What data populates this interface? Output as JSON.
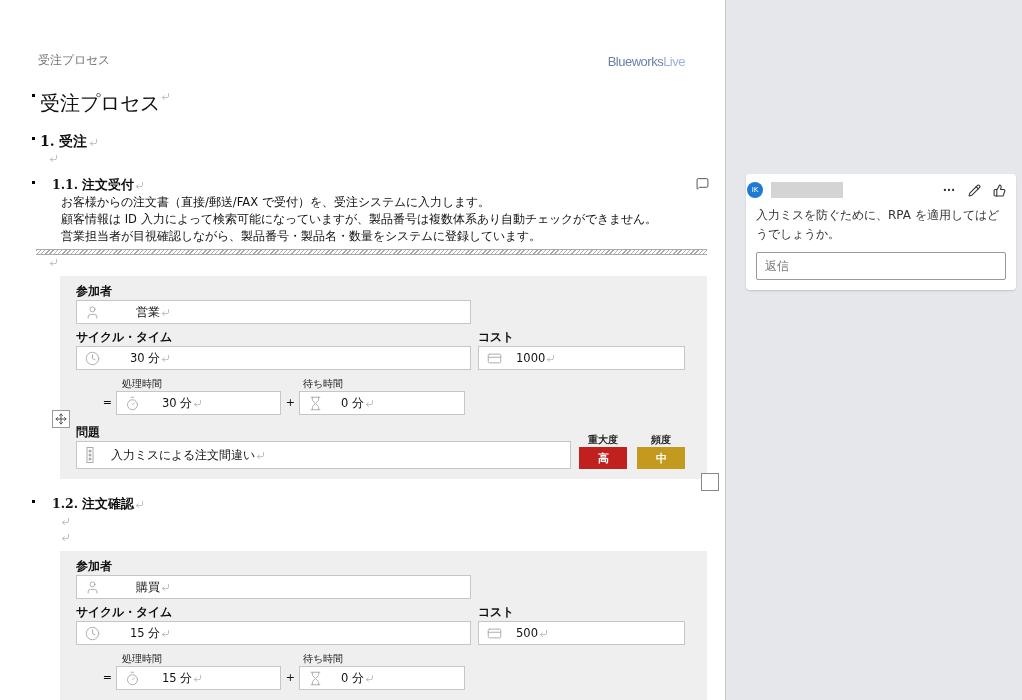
{
  "header": {
    "title": "受注プロセス",
    "logo": {
      "part_1": "Blueworks",
      "part_2": "Live"
    }
  },
  "heading": "受注プロセス",
  "sections": [
    {
      "title": "1. 受注",
      "subsections": [
        {
          "title": "1.1. 注文受付",
          "has_comment": true,
          "description": [
            "お客様からの注文書（直接/郵送/FAX で受付）を、受注システムに入力します。",
            "顧客情報は ID 入力によって検索可能になっていますが、製品番号は複数体系あり自動チェックができません。",
            "営業担当者が目視確認しながら、製品番号・製品名・数量をシステムに登録しています。"
          ],
          "card": {
            "participant_label": "参加者",
            "participant": "営業",
            "cycle_label": "サイクル・タイム",
            "cycle": "30 分",
            "cost_label": "コスト",
            "cost": "1000",
            "equals": "=",
            "processing_label": "処理時間",
            "processing": "30 分",
            "plus": "+",
            "wait_label": "待ち時間",
            "wait": "0 分",
            "issue": {
              "label": "問題",
              "value": "入力ミスによる注文間違い",
              "ratings": [
                {
                  "label": "重大度",
                  "value": "高",
                  "color": "#c0201e"
                },
                {
                  "label": "頻度",
                  "value": "中",
                  "color": "#c49a1e"
                }
              ]
            }
          }
        },
        {
          "title": "1.2. 注文確認",
          "has_comment": false,
          "card": {
            "participant_label": "参加者",
            "participant": "購買",
            "cycle_label": "サイクル・タイム",
            "cycle": "15 分",
            "cost_label": "コスト",
            "cost": "500",
            "equals": "=",
            "processing_label": "処理時間",
            "processing": "15 分",
            "plus": "+",
            "wait_label": "待ち時間",
            "wait": "0 分"
          }
        }
      ]
    }
  ],
  "comment": {
    "avatar": "IK",
    "text": "入力ミスを防ぐために、RPA を適用してはどうでしょうか。",
    "reply_placeholder": "返信"
  }
}
